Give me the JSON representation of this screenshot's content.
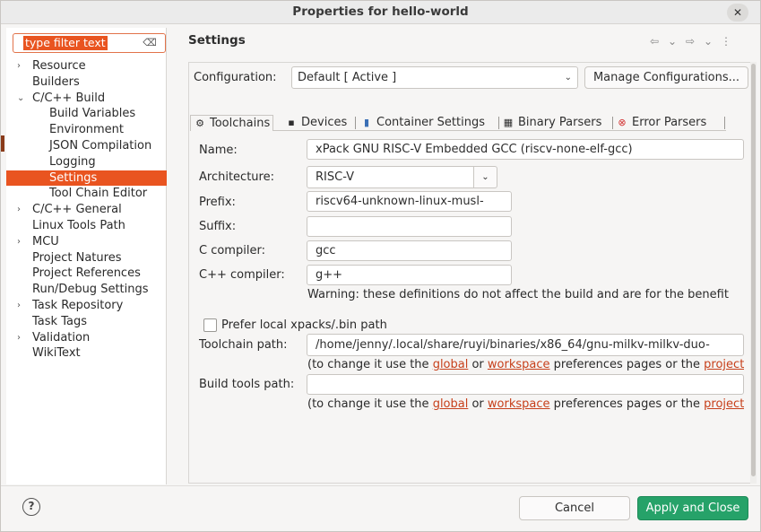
{
  "window": {
    "title": "Properties for hello-world",
    "close_glyph": "✕"
  },
  "filter": {
    "placeholder": "type filter text",
    "clear_glyph": "⌫"
  },
  "tree": {
    "items": [
      {
        "label": "Resource",
        "expandable": true,
        "expanded": false,
        "level": 0
      },
      {
        "label": "Builders",
        "expandable": false,
        "level": 0
      },
      {
        "label": "C/C++ Build",
        "expandable": true,
        "expanded": true,
        "level": 0
      },
      {
        "label": "Build Variables",
        "level": 1
      },
      {
        "label": "Environment",
        "level": 1
      },
      {
        "label": "JSON Compilation",
        "level": 1
      },
      {
        "label": "Logging",
        "level": 1
      },
      {
        "label": "Settings",
        "level": 1,
        "selected": true
      },
      {
        "label": "Tool Chain Editor",
        "level": 1
      },
      {
        "label": "C/C++ General",
        "expandable": true,
        "expanded": false,
        "level": 0
      },
      {
        "label": "Linux Tools Path",
        "level": 0
      },
      {
        "label": "MCU",
        "expandable": true,
        "expanded": false,
        "level": 0
      },
      {
        "label": "Project Natures",
        "level": 0
      },
      {
        "label": "Project References",
        "level": 0
      },
      {
        "label": "Run/Debug Settings",
        "level": 0
      },
      {
        "label": "Task Repository",
        "expandable": true,
        "expanded": false,
        "level": 0
      },
      {
        "label": "Task Tags",
        "level": 0
      },
      {
        "label": "Validation",
        "expandable": true,
        "expanded": false,
        "level": 0
      },
      {
        "label": "WikiText",
        "level": 0
      }
    ]
  },
  "page": {
    "title": "Settings"
  },
  "configuration": {
    "label": "Configuration:",
    "value": "Default  [ Active ]",
    "manage_label": "Manage Configurations..."
  },
  "tabs": [
    {
      "label": "Toolchains",
      "icon": "gear-icon",
      "active": true
    },
    {
      "label": "Devices",
      "icon": "chip-icon"
    },
    {
      "label": "Container Settings",
      "icon": "container-icon"
    },
    {
      "label": "Binary Parsers",
      "icon": "binary-icon"
    },
    {
      "label": "Error Parsers",
      "icon": "error-icon"
    }
  ],
  "toolchain": {
    "name_label": "Name:",
    "name_value": "xPack GNU RISC-V Embedded GCC (riscv-none-elf-gcc)",
    "arch_label": "Architecture:",
    "arch_value": "RISC-V",
    "prefix_label": "Prefix:",
    "prefix_value": "riscv64-unknown-linux-musl-",
    "suffix_label": "Suffix:",
    "suffix_value": "",
    "c_label": "C compiler:",
    "c_value": "gcc",
    "cpp_label": "C++ compiler:",
    "cpp_value": "g++",
    "warning": "Warning: these definitions do not affect the build and are for the benefit",
    "prefer_label": "Prefer local xpacks/.bin path",
    "path_label": "Toolchain path:",
    "path_value": "/home/jenny/.local/share/ruyi/binaries/x86_64/gnu-milkv-milkv-duo-",
    "build_tools_label": "Build tools path:",
    "build_tools_value": "",
    "hint_prefix": "(to change it use the ",
    "hint_global": "global",
    "hint_or": " or ",
    "hint_workspace": "workspace",
    "hint_suffix": " preferences pages or the ",
    "hint_project": "project"
  },
  "footer": {
    "help_glyph": "?",
    "cancel_label": "Cancel",
    "apply_label": "Apply and Close"
  },
  "colors": {
    "accent": "#e95420",
    "apply": "#26a269",
    "link": "#c7401b"
  }
}
